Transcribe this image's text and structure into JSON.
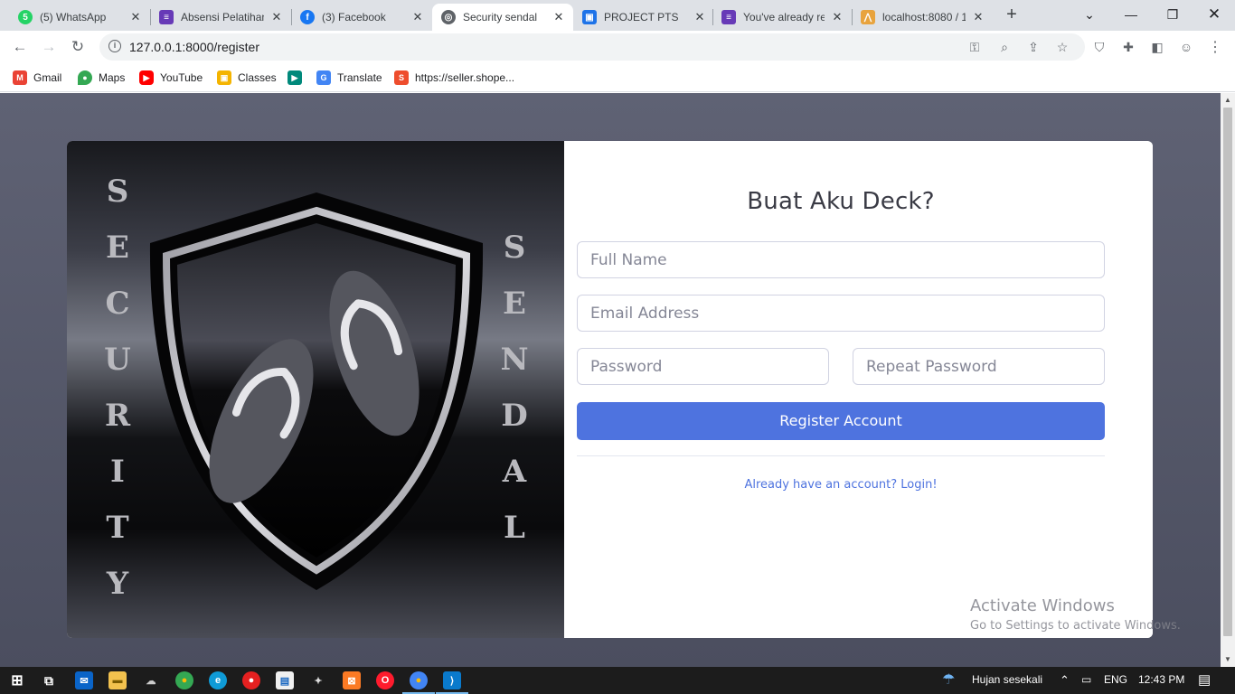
{
  "browser": {
    "tabs": [
      {
        "title": "(5) WhatsApp",
        "icon": "whatsapp-icon",
        "color": "#25d366",
        "glyph": "5",
        "active": false
      },
      {
        "title": "Absensi Pelatihan",
        "icon": "forms-icon",
        "color": "#673ab7",
        "glyph": "≡",
        "active": false
      },
      {
        "title": "(3) Facebook",
        "icon": "facebook-icon",
        "color": "#1877f2",
        "glyph": "f",
        "active": false
      },
      {
        "title": "Security sendal",
        "icon": "globe-icon",
        "color": "#5f6368",
        "glyph": "◎",
        "active": true
      },
      {
        "title": "PROJECT PTS",
        "icon": "classroom-icon",
        "color": "#1e73e8",
        "glyph": "▣",
        "active": false
      },
      {
        "title": "You've already re",
        "icon": "forms-icon",
        "color": "#673ab7",
        "glyph": "≡",
        "active": false
      },
      {
        "title": "localhost:8080 / 1",
        "icon": "phpmyadmin-icon",
        "color": "#e8a33d",
        "glyph": "⋀",
        "active": false
      }
    ],
    "url": "127.0.0.1:8000/register",
    "bookmarks": [
      {
        "label": "Gmail",
        "icon": "gmail-icon",
        "color": "#ea4335",
        "glyph": "M"
      },
      {
        "label": "Maps",
        "icon": "maps-icon",
        "color": "#34a853",
        "glyph": "●"
      },
      {
        "label": "YouTube",
        "icon": "youtube-icon",
        "color": "#ff0000",
        "glyph": "▶"
      },
      {
        "label": "Classes",
        "icon": "classroom-icon",
        "color": "#f4b400",
        "glyph": "▣"
      },
      {
        "label": "",
        "icon": "meet-icon",
        "color": "#00897b",
        "glyph": "▶"
      },
      {
        "label": "Translate",
        "icon": "translate-icon",
        "color": "#4285f4",
        "glyph": "G"
      },
      {
        "label": "https://seller.shope...",
        "icon": "shopee-icon",
        "color": "#ee4d2d",
        "glyph": "S"
      }
    ]
  },
  "page": {
    "brand_left": [
      "S",
      "E",
      "C",
      "U",
      "R",
      "I",
      "T",
      "Y"
    ],
    "brand_right": [
      "S",
      "E",
      "N",
      "D",
      "A",
      "L"
    ],
    "heading": "Buat Aku Deck?",
    "form": {
      "full_name_placeholder": "Full Name",
      "email_placeholder": "Email Address",
      "password_placeholder": "Password",
      "repeat_password_placeholder": "Repeat Password",
      "submit_label": "Register Account",
      "login_link": "Already have an account? Login!"
    },
    "watermark": {
      "line1": "Activate Windows",
      "line2": "Go to Settings to activate Windows."
    }
  },
  "taskbar": {
    "weather": "Hujan sesekali",
    "language": "ENG",
    "time": "12:43 PM"
  },
  "colors": {
    "accent": "#4e73df",
    "page_bg": "#5a5c69"
  }
}
